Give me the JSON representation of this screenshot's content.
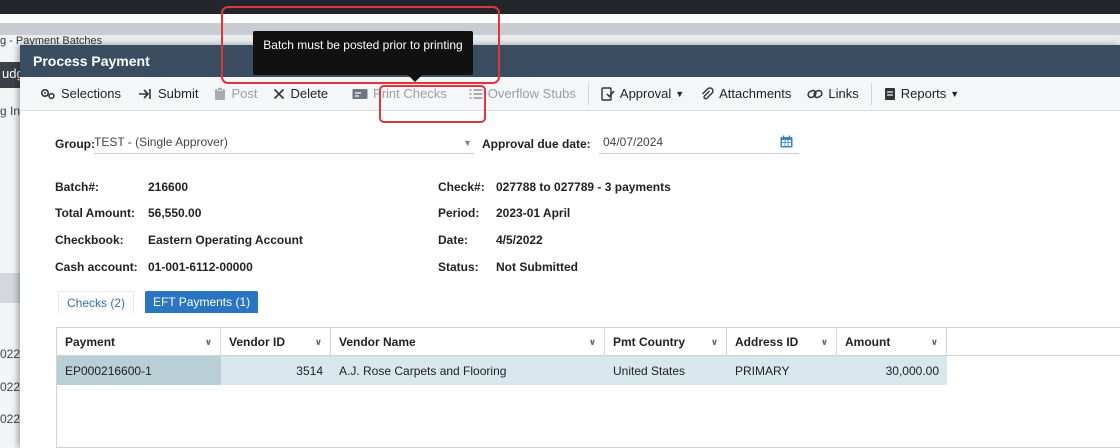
{
  "background": {
    "tab_text": "g - Payment Batches",
    "dark_label": "udg",
    "side_label": "g In",
    "rows": [
      "022",
      "022",
      "022"
    ]
  },
  "modal": {
    "title": "Process Payment"
  },
  "toolbar": {
    "selections": "Selections",
    "submit": "Submit",
    "post": "Post",
    "delete": "Delete",
    "print_checks": "Print Checks",
    "overflow_stubs": "Overflow Stubs",
    "approval": "Approval",
    "attachments": "Attachments",
    "links": "Links",
    "reports": "Reports"
  },
  "tooltip": {
    "text": "Batch must be posted prior to printing"
  },
  "form": {
    "group_label": "Group:",
    "group_value": "TEST - (Single Approver)",
    "approval_label": "Approval due date:",
    "approval_value": "04/07/2024"
  },
  "batch": {
    "batch_label": "Batch#:",
    "batch_value": "216600",
    "total_label": "Total Amount:",
    "total_value": "56,550.00",
    "checkbook_label": "Checkbook:",
    "checkbook_value": "Eastern Operating Account",
    "cash_label": "Cash account:",
    "cash_value": "01-001-6112-00000",
    "check_label": "Check#:",
    "check_value": "027788 to 027789 - 3 payments",
    "period_label": "Period:",
    "period_value": "2023-01 April",
    "date_label": "Date:",
    "date_value": "4/5/2022",
    "status_label": "Status:",
    "status_value": "Not Submitted"
  },
  "tabs": {
    "checks": "Checks (2)",
    "eft": "EFT Payments (1)"
  },
  "grid": {
    "columns": [
      "Payment",
      "Vendor ID",
      "Vendor Name",
      "Pmt Country",
      "Address ID",
      "Amount"
    ],
    "rows": [
      {
        "payment": "EP000216600-1",
        "vendor_id": "3514",
        "vendor_name": "A.J. Rose Carpets and Flooring",
        "country": "United States",
        "address_id": "PRIMARY",
        "amount": "30,000.00"
      }
    ]
  },
  "colors": {
    "title_bar": "#3a4c60",
    "accent_tab": "#2a75c2",
    "highlight": "#e0353b",
    "row_fill": "#d7e7ec"
  }
}
